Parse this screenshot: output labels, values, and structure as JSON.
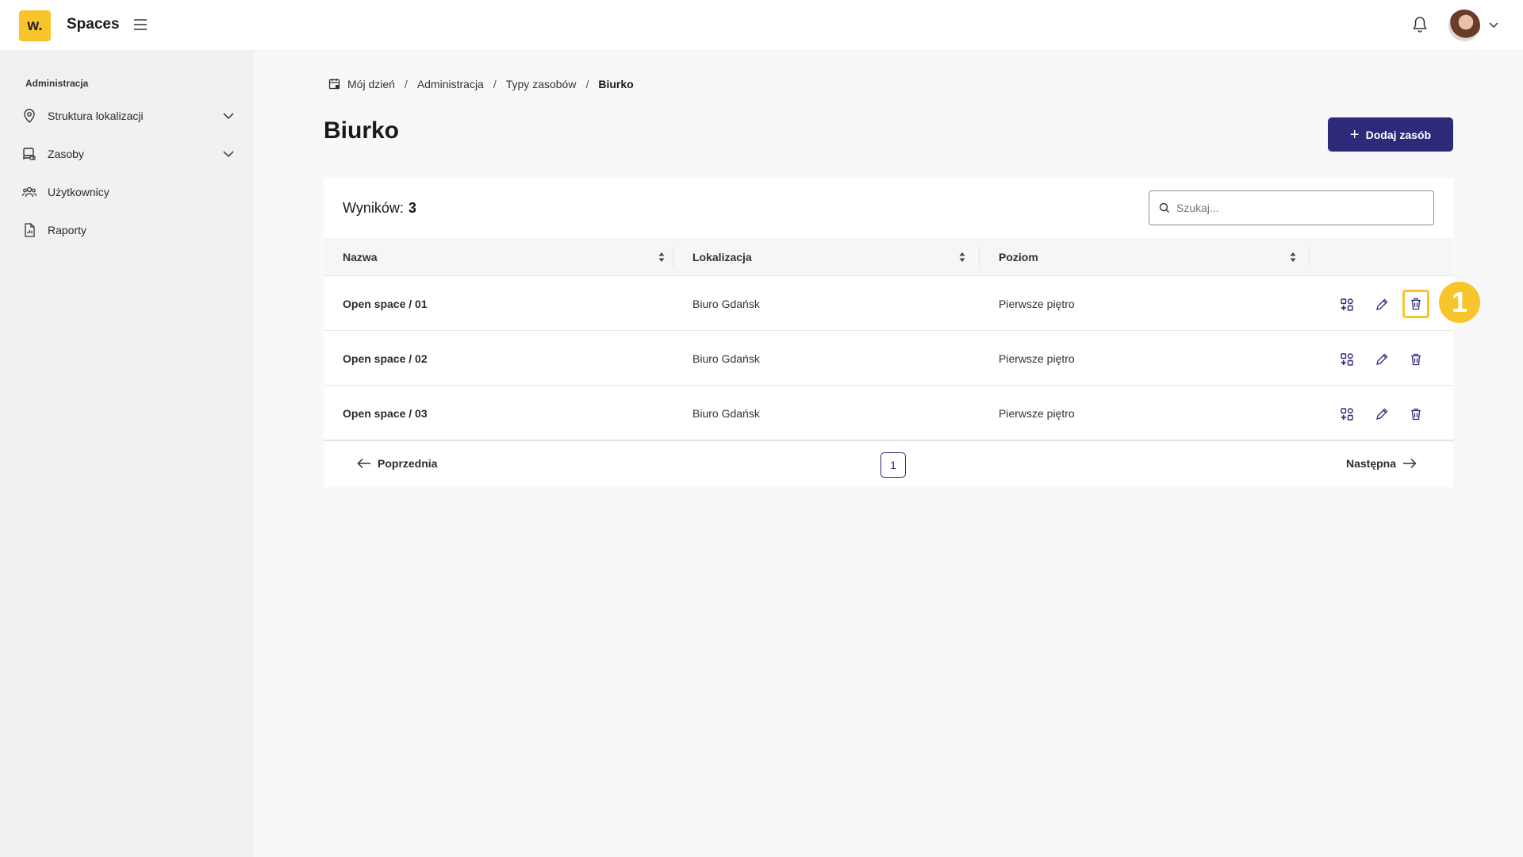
{
  "header": {
    "logo_text": "w.",
    "app_title": "Spaces"
  },
  "sidebar": {
    "section_label": "Administracja",
    "items": [
      {
        "label": "Struktura lokalizacji",
        "icon": "location-pin-icon",
        "expandable": true
      },
      {
        "label": "Zasoby",
        "icon": "resources-icon",
        "expandable": true
      },
      {
        "label": "Użytkownicy",
        "icon": "users-icon",
        "expandable": false
      },
      {
        "label": "Raporty",
        "icon": "report-icon",
        "expandable": false
      }
    ]
  },
  "breadcrumb": {
    "items": [
      "Mój dzień",
      "Administracja",
      "Typy zasobów",
      "Biurko"
    ],
    "separator": "/"
  },
  "page": {
    "title": "Biurko",
    "add_button_label": "Dodaj zasób"
  },
  "table": {
    "results_label": "Wyników:",
    "results_count": "3",
    "search_placeholder": "Szukaj...",
    "columns": [
      "Nazwa",
      "Lokalizacja",
      "Poziom"
    ],
    "rows": [
      {
        "name": "Open space / 01",
        "location": "Biuro Gdańsk",
        "level": "Pierwsze piętro"
      },
      {
        "name": "Open space / 02",
        "location": "Biuro Gdańsk",
        "level": "Pierwsze piętro"
      },
      {
        "name": "Open space / 03",
        "location": "Biuro Gdańsk",
        "level": "Pierwsze piętro"
      }
    ],
    "row_actions": [
      "attributes-icon",
      "edit-icon",
      "delete-icon"
    ]
  },
  "pagination": {
    "prev_label": "Poprzednia",
    "next_label": "Następna",
    "current_page": "1"
  },
  "annotation": {
    "step_number": "1"
  },
  "colors": {
    "brand_yellow": "#f7c52b",
    "primary": "#2e2a7a",
    "sidebar_bg": "#f1f1f1"
  }
}
